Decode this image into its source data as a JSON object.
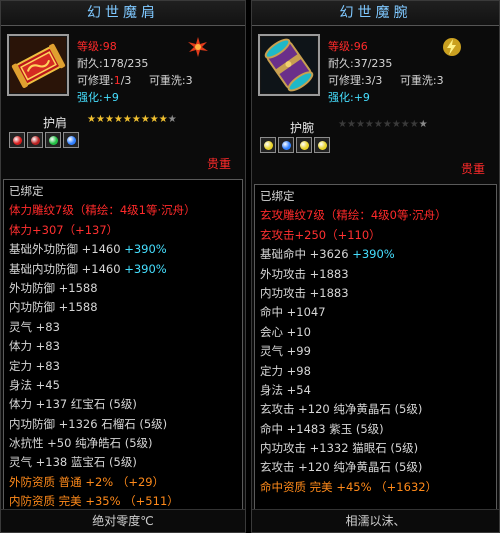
{
  "panels": [
    {
      "title": "幻世魔肩",
      "level_label": "等级:",
      "level": "98",
      "durability_label": "耐久:",
      "durability": "178/235",
      "repairable_label": "可修理:",
      "repairable_cur": "1",
      "repairable_max": "/3",
      "rewash_label": "可重洗:",
      "rewash": "3",
      "enhance_label": "强化:",
      "enhance": "+9",
      "slot_name": "护肩",
      "stars_lit": 9,
      "stars_total": 10,
      "precious": "贵重",
      "gems": [
        "#d81b1b",
        "#b82020",
        "#22c044",
        "#2f7fff"
      ],
      "bound": "已绑定",
      "craft_line": "体力雕纹7级（精绘：4级1等·沉舟）",
      "craft_bonus": "体力+307（+137）",
      "attributes": [
        {
          "name": "基础外功防御",
          "value": "+1460",
          "extra": "+390%"
        },
        {
          "name": "基础内功防御",
          "value": "+1460",
          "extra": "+390%"
        },
        {
          "name": "外功防御",
          "value": "+1588",
          "extra": ""
        },
        {
          "name": "内功防御",
          "value": "+1588",
          "extra": ""
        },
        {
          "name": "灵气",
          "value": "+83",
          "extra": ""
        },
        {
          "name": "体力",
          "value": "+83",
          "extra": ""
        },
        {
          "name": "定力",
          "value": "+83",
          "extra": ""
        },
        {
          "name": "身法",
          "value": "+45",
          "extra": ""
        },
        {
          "name": "体力",
          "value": "+137",
          "extra": "红宝石 (5级)"
        },
        {
          "name": "内功防御",
          "value": "+1326",
          "extra": "石榴石 (5级)"
        },
        {
          "name": "冰抗性",
          "value": "+50",
          "extra": "纯净皓石 (5级)"
        },
        {
          "name": "灵气",
          "value": "+138",
          "extra": "蓝宝石 (5级)"
        }
      ],
      "quality": [
        {
          "name": "外防资质",
          "grade": "普通",
          "value": "+2%",
          "extra": "（+29）"
        },
        {
          "name": "内防资质",
          "grade": "完美",
          "value": "+35%",
          "extra": "（+511）"
        }
      ],
      "footer": "绝对零度℃"
    },
    {
      "title": "幻世魔腕",
      "level_label": "等级:",
      "level": "96",
      "durability_label": "耐久:",
      "durability": "37/235",
      "repairable_label": "可修理:",
      "repairable_cur": "3",
      "repairable_max": "/3",
      "rewash_label": "可重洗:",
      "rewash": "3",
      "enhance_label": "强化:",
      "enhance": "+9",
      "slot_name": "护腕",
      "stars_lit": 0,
      "stars_total": 10,
      "precious": "贵重",
      "gems": [
        "#e8d32a",
        "#2f7fff",
        "#e8d32a",
        "#e8d32a"
      ],
      "bound": "已绑定",
      "craft_line": "玄攻雕纹7级（精绘：4级0等·沉舟）",
      "craft_bonus": "玄攻击+250（+110）",
      "attributes": [
        {
          "name": "基础命中",
          "value": "+3626",
          "extra": "+390%"
        },
        {
          "name": "外功攻击",
          "value": "+1883",
          "extra": ""
        },
        {
          "name": "内功攻击",
          "value": "+1883",
          "extra": ""
        },
        {
          "name": "命中",
          "value": "+1047",
          "extra": ""
        },
        {
          "name": "会心",
          "value": "+10",
          "extra": ""
        },
        {
          "name": "灵气",
          "value": "+99",
          "extra": ""
        },
        {
          "name": "定力",
          "value": "+98",
          "extra": ""
        },
        {
          "name": "身法",
          "value": "+54",
          "extra": ""
        },
        {
          "name": "玄攻击",
          "value": "+120",
          "extra": "纯净黄晶石 (5级)"
        },
        {
          "name": "命中",
          "value": "+1483",
          "extra": "紫玉 (5级)"
        },
        {
          "name": "内功攻击",
          "value": "+1332",
          "extra": "猫眼石 (5级)"
        },
        {
          "name": "玄攻击",
          "value": "+120",
          "extra": "纯净黄晶石 (5级)"
        }
      ],
      "quality": [
        {
          "name": "命中资质",
          "grade": "完美",
          "value": "+45%",
          "extra": "（+1632）"
        }
      ],
      "footer": "相濡以沫、"
    }
  ]
}
